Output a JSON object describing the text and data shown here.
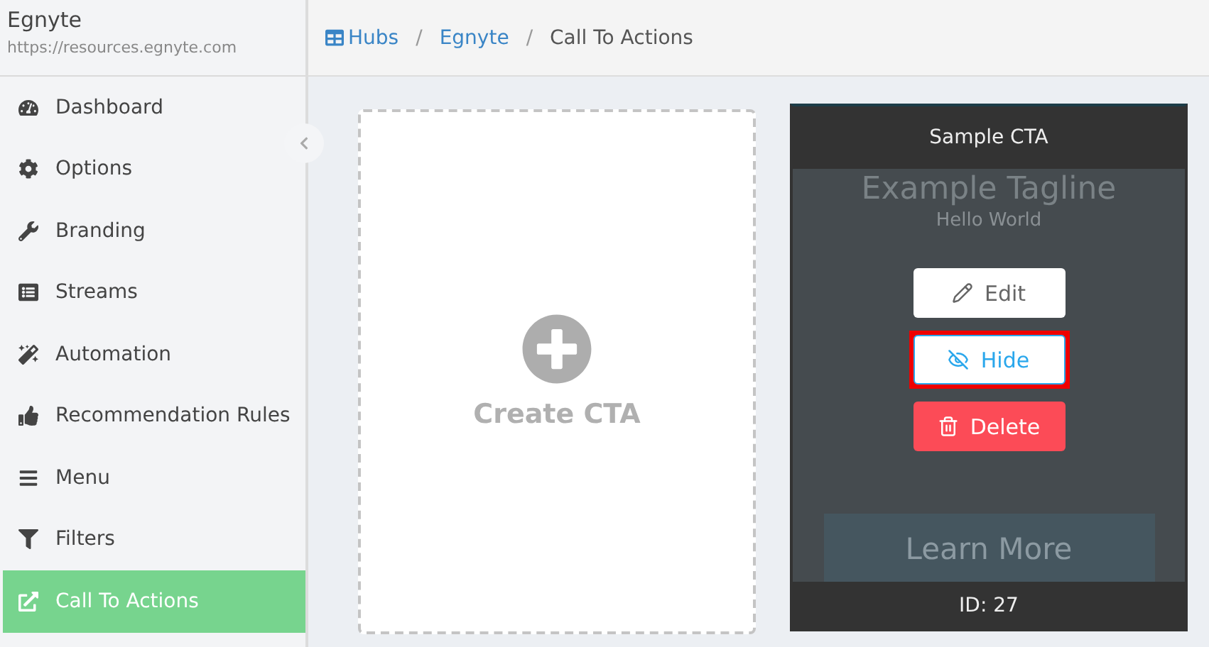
{
  "site": {
    "name": "Egnyte",
    "url": "https://resources.egnyte.com"
  },
  "sidebar": {
    "items": [
      {
        "label": "Dashboard",
        "selected": false
      },
      {
        "label": "Options",
        "selected": false
      },
      {
        "label": "Branding",
        "selected": false
      },
      {
        "label": "Streams",
        "selected": false
      },
      {
        "label": "Automation",
        "selected": false
      },
      {
        "label": "Recommendation Rules",
        "selected": false
      },
      {
        "label": "Menu",
        "selected": false
      },
      {
        "label": "Filters",
        "selected": false
      },
      {
        "label": "Call To Actions",
        "selected": true
      }
    ]
  },
  "breadcrumb": [
    {
      "label": "Hubs",
      "link": true
    },
    {
      "label": "Egnyte",
      "link": true
    },
    {
      "label": "Call To Actions",
      "link": false
    }
  ],
  "separator": "/",
  "create_card": {
    "label": "Create CTA"
  },
  "cta_card": {
    "title": "Sample CTA",
    "tagline": "Example Tagline",
    "subtitle": "Hello World",
    "cta_button": "Learn More",
    "footer": "ID: 27",
    "actions": [
      {
        "label": "Edit",
        "kind": "edit",
        "highlighted": false
      },
      {
        "label": "Hide",
        "kind": "hide",
        "highlighted": true
      },
      {
        "label": "Delete",
        "kind": "delete",
        "highlighted": false
      }
    ]
  }
}
